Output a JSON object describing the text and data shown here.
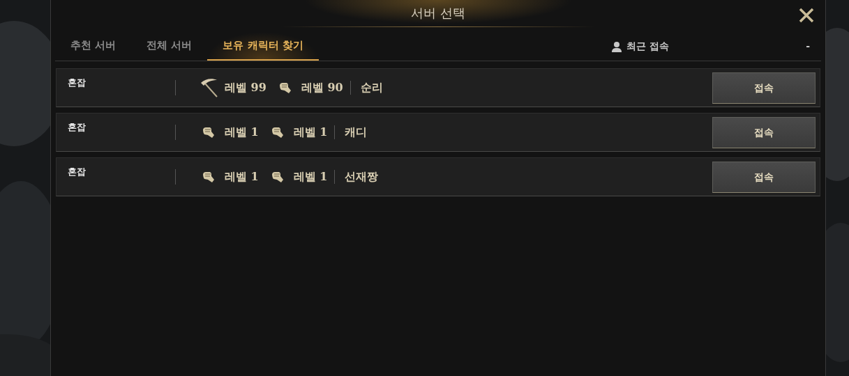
{
  "window": {
    "title": "서버 선택"
  },
  "tabs": [
    {
      "label": "추천 서버",
      "selected": false
    },
    {
      "label": "전체 서버",
      "selected": false
    },
    {
      "label": "보유 캐릭터 찾기",
      "selected": true
    }
  ],
  "recent": {
    "label": "최근 접속",
    "value": "-"
  },
  "rows": [
    {
      "server": "혼잡",
      "classes": [
        {
          "kind": "pickaxe",
          "level": "레벨 99"
        },
        {
          "kind": "fist",
          "level": "레벨 90"
        }
      ],
      "name": "순리",
      "button": "접속"
    },
    {
      "server": "혼잡",
      "classes": [
        {
          "kind": "fist",
          "level": "레벨 1"
        },
        {
          "kind": "fist",
          "level": "레벨 1"
        }
      ],
      "name": "캐디",
      "button": "접속"
    },
    {
      "server": "혼잡",
      "classes": [
        {
          "kind": "fist",
          "level": "레벨 1"
        },
        {
          "kind": "fist",
          "level": "레벨 1"
        }
      ],
      "name": "선재짱",
      "button": "접속"
    }
  ]
}
